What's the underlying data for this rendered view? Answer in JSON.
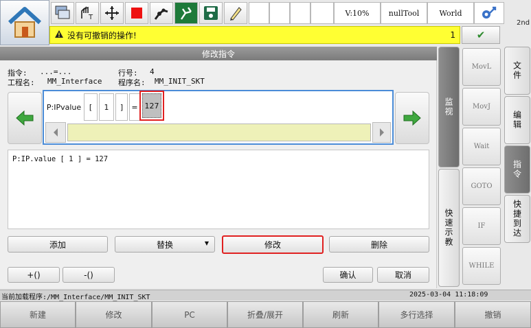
{
  "topbar": {
    "status_speed": "V:10%",
    "status_tool": "nullTool",
    "status_frame": "World",
    "edge_label": "2nd",
    "icons": [
      "home-icon",
      "multi-window-icon",
      "hand-teach-icon",
      "axis-cross-icon",
      "stop-icon",
      "robot-arm-icon",
      "run-mode-icon",
      "save-icon",
      "pen-tool-icon",
      "settings-robot-icon"
    ]
  },
  "warning": {
    "message": "没有可撤销的操作!",
    "count": "1",
    "confirm_symbol": "✔"
  },
  "dialog": {
    "title": "修改指令",
    "instr_label": "指令:",
    "instr_value": "...=...",
    "line_label": "行号:",
    "line_value": "4",
    "project_label": "工程名:",
    "project_value": "MM_Interface",
    "program_label": "程序名:",
    "program_value": "MM_INIT_SKT",
    "tokens": [
      "P:IPvalue",
      "[",
      "1",
      "]",
      "=",
      "127"
    ],
    "text_content": "P:IP.value [ 1 ] = 127",
    "btn_add": "添加",
    "btn_replace": "替换",
    "btn_modify": "修改",
    "btn_delete": "删除",
    "btn_paren_add": "+()",
    "btn_paren_remove": "-()",
    "btn_ok": "确认",
    "btn_cancel": "取消"
  },
  "side_tabs": {
    "monitor": "监视",
    "quick_teach": "快速示教",
    "file": "文件",
    "edit": "编辑",
    "instruction": "指令",
    "quick_jump": "快捷到达"
  },
  "side_commands": [
    "MovL",
    "MovJ",
    "Wait",
    "GOTO",
    "IF",
    "WHILE"
  ],
  "status": {
    "loaded_program": "当前加载程序:/MM_Interface/MM_INIT_SKT",
    "datetime": "2025-03-04 11:18:09"
  },
  "bottom": [
    "新建",
    "修改",
    "PC",
    "折叠/展开",
    "刷新",
    "多行选择",
    "撤销"
  ],
  "colors": {
    "warning_bg": "#ffff33",
    "highlight_red": "#e02020",
    "editor_border": "#4a8cd8",
    "scroll_fill": "#eef1b8",
    "arrow_green": "#3fa83f"
  }
}
